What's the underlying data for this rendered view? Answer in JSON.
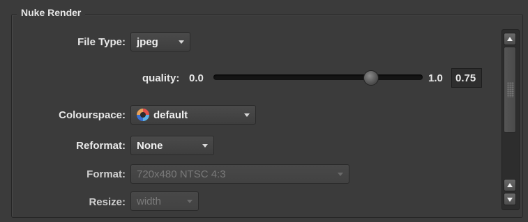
{
  "panel": {
    "title": "Nuke Render"
  },
  "file_type": {
    "label": "File Type:",
    "value": "jpeg"
  },
  "quality": {
    "label": "quality:",
    "min_label": "0.0",
    "max_label": "1.0",
    "value": 0.75,
    "value_text": "0.75"
  },
  "colourspace": {
    "label": "Colourspace:",
    "value": "default",
    "icon": "colour-wheel-icon"
  },
  "reformat": {
    "label": "Reformat:",
    "value": "None"
  },
  "format": {
    "label": "Format:",
    "value": "720x480 NTSC 4:3",
    "enabled": false
  },
  "resize": {
    "label": "Resize:",
    "value": "width",
    "enabled": false
  },
  "colors": {
    "background": "#3b3b3b",
    "text": "#e8e8e8",
    "disabled_text": "#7a7a7a",
    "track": "#141414"
  }
}
